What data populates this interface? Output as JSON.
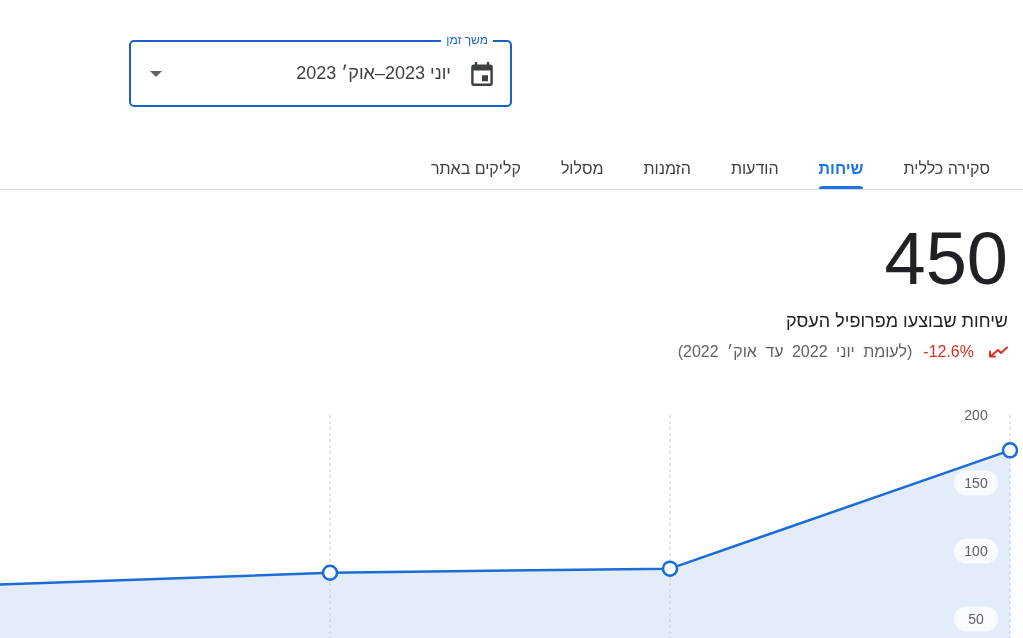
{
  "date_range": {
    "label": "משך זמן",
    "value": "יוני 2023–אוק׳ 2023"
  },
  "tabs": [
    {
      "label": "סקירה כללית",
      "selected": false
    },
    {
      "label": "שיחות",
      "selected": true
    },
    {
      "label": "הודעות",
      "selected": false
    },
    {
      "label": "הזמנות",
      "selected": false
    },
    {
      "label": "מסלול",
      "selected": false
    },
    {
      "label": "קליקים באתר",
      "selected": false
    }
  ],
  "summary": {
    "total": "450",
    "title": "שיחות שבוצעו מפרופיל העסק",
    "trend_down": true,
    "change": "-12.6%",
    "comparison": "(לעומת יוני 2022 עד אוק׳ 2022)"
  },
  "chart": {
    "chart_data": {
      "type": "area",
      "categories": [
        null,
        null,
        null,
        null
      ],
      "series": [
        {
          "color": "#1a6dd6",
          "values": [
            75,
            84,
            87,
            174
          ]
        }
      ],
      "ylim": [
        36,
        200
      ],
      "yticks": [
        50,
        100,
        150,
        200
      ],
      "grid": "x"
    }
  }
}
